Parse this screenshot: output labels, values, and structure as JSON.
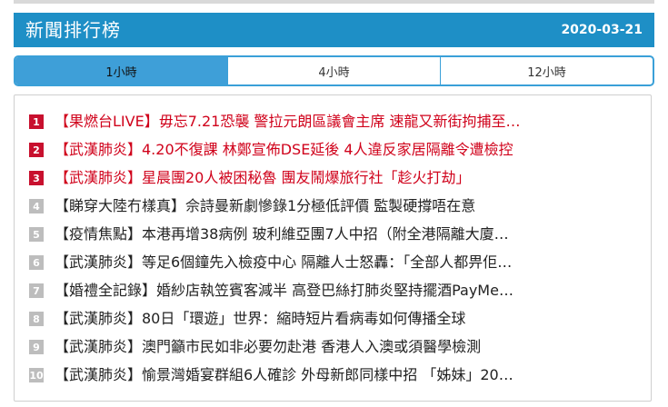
{
  "header": {
    "title": "新聞排行榜",
    "date": "2020-03-21"
  },
  "tabs": [
    {
      "label": "1小時",
      "active": true
    },
    {
      "label": "4小時",
      "active": false
    },
    {
      "label": "12小時",
      "active": false
    }
  ],
  "colors": {
    "header_bg": "#1e8fc6",
    "tab_active_bg": "#3e9fd8",
    "top_rank_red": "#d0021b",
    "rank_gray": "#bdbdbd"
  },
  "ranking": [
    {
      "rank": "1",
      "title": "【果燃台LIVE】毋忘7.21恐襲 警拉元朗區議會主席 速龍又新街拘捕至…",
      "highlight": true
    },
    {
      "rank": "2",
      "title": "【武漢肺炎】4.20不復課 林鄭宣佈DSE延後 4人違反家居隔離令遭檢控",
      "highlight": true
    },
    {
      "rank": "3",
      "title": "【武漢肺炎】星晨團20人被困秘魯 團友鬧爆旅行社「趁火打劫」",
      "highlight": true
    },
    {
      "rank": "4",
      "title": "【睇穿大陸冇樣真】佘詩曼新劇慘錄1分極低評價 監製硬撐唔在意",
      "highlight": false
    },
    {
      "rank": "5",
      "title": "【疫情焦點】本港再增38病例 玻利維亞團7人中招（附全港隔離大廈…",
      "highlight": false
    },
    {
      "rank": "6",
      "title": "【武漢肺炎】等足6個鐘先入檢疫中心 隔離人士怒轟：「全部人都畀佢…",
      "highlight": false
    },
    {
      "rank": "7",
      "title": "【婚禮全記錄】婚紗店執笠賓客減半 高登巴絲打肺炎堅持擺酒PayMe…",
      "highlight": false
    },
    {
      "rank": "8",
      "title": "【武漢肺炎】80日「環遊」世界：縮時短片看病毒如何傳播全球",
      "highlight": false
    },
    {
      "rank": "9",
      "title": "【武漢肺炎】澳門籲市民如非必要勿赴港 香港人入澳或須醫學檢測",
      "highlight": false
    },
    {
      "rank": "10",
      "title": "【武漢肺炎】愉景灣婚宴群組6人確診 外母新郎同樣中招 「姊妹」20…",
      "highlight": false
    }
  ]
}
